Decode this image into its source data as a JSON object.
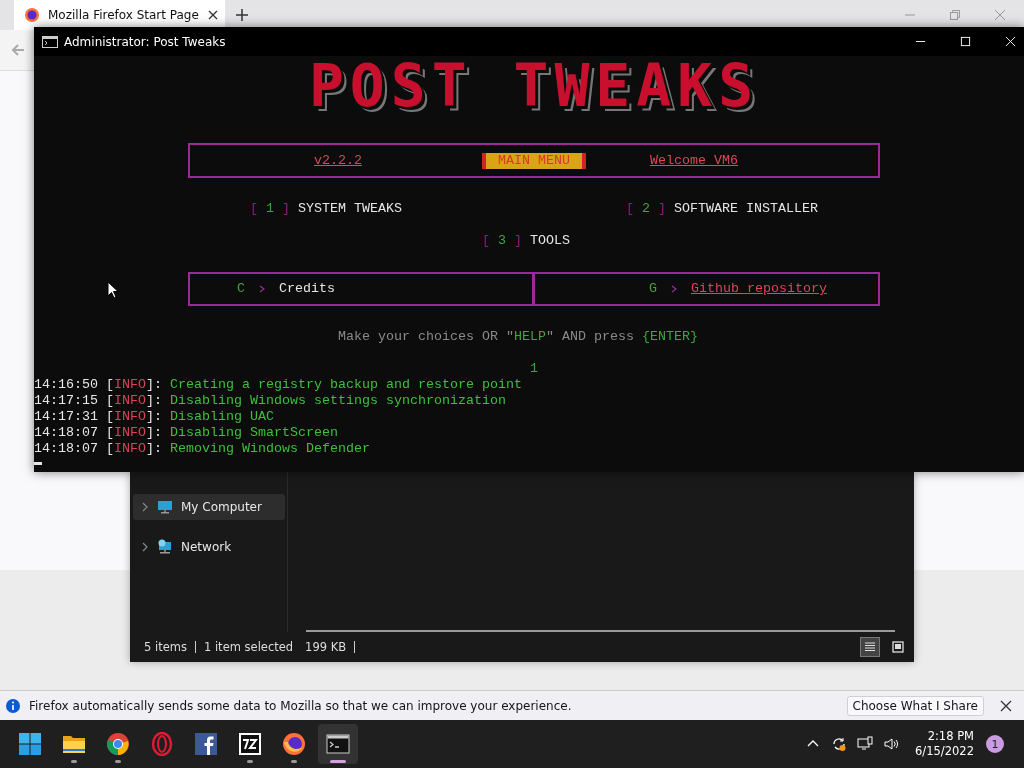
{
  "browser": {
    "tab_title": "Mozilla Firefox Start Page",
    "notification": {
      "text": "Firefox automatically sends some data to Mozilla so that we can improve your experience.",
      "button": "Choose What I Share"
    }
  },
  "console": {
    "title": "Administrator:  Post Tweaks",
    "banner": "POST TWEAKS",
    "header": {
      "version": "v2.2.2",
      "menu": "MAIN MENU",
      "welcome": "Welcome VM6"
    },
    "options": [
      {
        "open": "[",
        "key": "1",
        "close": "]",
        "label": "SYSTEM TWEAKS"
      },
      {
        "open": "[",
        "key": "2",
        "close": "]",
        "label": "SOFTWARE INSTALLER"
      },
      {
        "open": "[",
        "key": "3",
        "close": "]",
        "label": "TOOLS"
      }
    ],
    "links": [
      {
        "key": "C",
        "label": "Credits",
        "kind": "plain"
      },
      {
        "key": "G",
        "label": "Github repository",
        "kind": "link"
      }
    ],
    "prompt": [
      {
        "text": "Make your choices OR \"",
        "kind": "plain"
      },
      {
        "text": "HELP",
        "kind": "key"
      },
      {
        "text": "\" AND press ",
        "kind": "plain"
      },
      {
        "text": "{ENTER}",
        "kind": "key"
      }
    ],
    "input": "1",
    "log": [
      {
        "time": "14:16:50",
        "open": "[",
        "level": "INFO",
        "close": "]:",
        "message": "Creating a registry backup and restore point"
      },
      {
        "time": "14:17:15",
        "open": "[",
        "level": "INFO",
        "close": "]:",
        "message": "Disabling Windows settings synchronization"
      },
      {
        "time": "14:17:31",
        "open": "[",
        "level": "INFO",
        "close": "]:",
        "message": "Disabling UAC"
      },
      {
        "time": "14:18:07",
        "open": "[",
        "level": "INFO",
        "close": "]:",
        "message": "Disabling SmartScreen"
      },
      {
        "time": "14:18:07",
        "open": "[",
        "level": "INFO",
        "close": "]:",
        "message": "Removing Windows Defender"
      }
    ]
  },
  "explorer": {
    "tree": [
      {
        "label": "My Computer",
        "kind": "computer",
        "selected": true
      },
      {
        "label": "Network",
        "kind": "network",
        "selected": false
      }
    ],
    "status": {
      "items": "5 items",
      "selection": "1 item selected",
      "size": "199 KB"
    },
    "views": [
      {
        "kind": "details",
        "selected": true
      },
      {
        "kind": "tiles",
        "selected": false
      }
    ]
  },
  "taskbar": {
    "apps": [
      {
        "kind": "start",
        "running": false,
        "selected": false
      },
      {
        "kind": "folder",
        "running": true,
        "selected": false
      },
      {
        "kind": "chrome",
        "running": true,
        "selected": false
      },
      {
        "kind": "opera",
        "running": false,
        "selected": false
      },
      {
        "kind": "facebook",
        "running": false,
        "selected": false
      },
      {
        "kind": "archiver",
        "running": true,
        "selected": false
      },
      {
        "kind": "firefox",
        "running": true,
        "selected": false
      },
      {
        "kind": "terminal",
        "running": true,
        "selected": true
      }
    ],
    "time": "2:18 PM",
    "date": "6/15/2022",
    "badge": "1"
  }
}
